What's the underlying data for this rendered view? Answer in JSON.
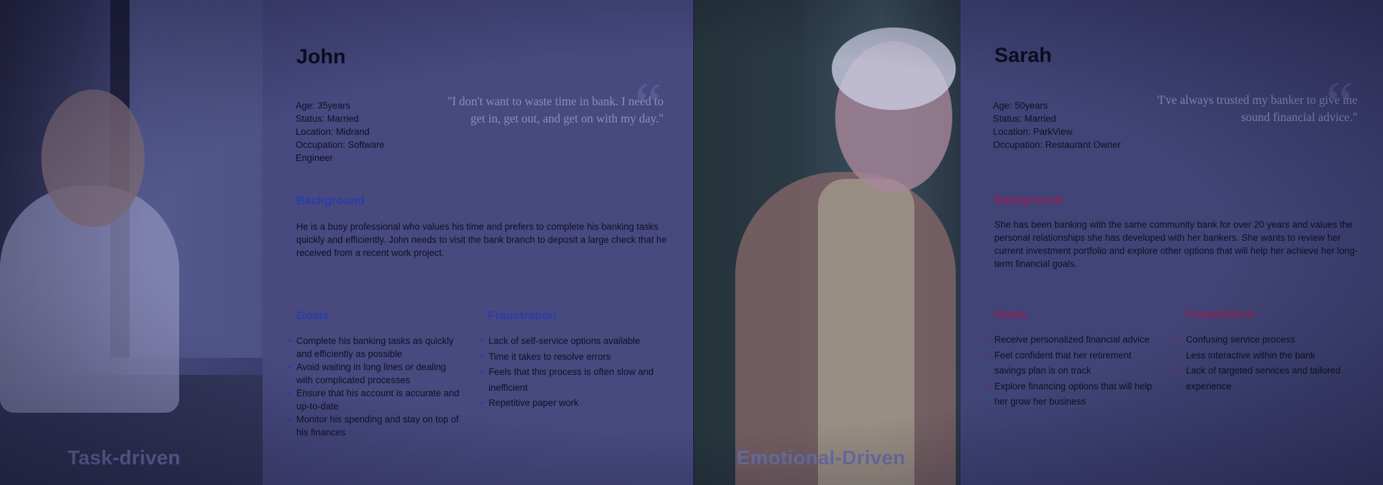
{
  "personas": [
    {
      "caption": "Task-driven",
      "name": "John",
      "meta": [
        "Age: 35years",
        "Status: Married",
        "Location: Midrand",
        "Occupation: Software",
        "Engineer"
      ],
      "quote_lines": [
        "\"I don't want to waste time in bank. I need to",
        "get in, get out, and get on with my day.\""
      ],
      "background_title": "Background",
      "background_text": "He is a busy professional who values his time and prefers to complete his banking tasks quickly and efficiently. John needs to visit the bank branch to deposit a large check that he received from a recent work project.",
      "goals_title": "Goals",
      "goals": [
        "Complete his banking tasks as quickly and efficiently as possible",
        "Avoid waiting in long lines or dealing with complicated processes",
        "Ensure that his account is accurate and up-to-date",
        "Monitor his spending and stay on top of his finances"
      ],
      "frustration_title": "Fraustration",
      "frustrations": [
        "Lack of self-service options available",
        "Time it takes to resolve errors",
        "Feels that this process is often slow and inefficient",
        "Repetitive paper work"
      ]
    },
    {
      "caption": "Emotional-Driven",
      "name": "Sarah",
      "meta": [
        "Age: 50years",
        "Status: Married",
        "Location: ParkView",
        "Occupation: Restaurant Owner"
      ],
      "quote_lines": [
        "'I've always trusted my banker to give me",
        "sound financial advice.\""
      ],
      "background_title": "Background",
      "background_text": "She has been banking with the same community bank for over 20 years and values the personal relationships she has developed with her bankers. She wants to review her current investment portfolio and explore other options that will help her achieve her long-term financial goals.",
      "goals_title": "Goals",
      "goals": [
        "Receive personalized financial advice",
        "Feel confident that her retirement savings plan is on track",
        "Explore financing options that will help her grow her business"
      ],
      "frustration_title": "Fraustration",
      "frustrations": [
        "Confusing service process",
        "Less interactive within the bank",
        "Lack of targeted services and tailored experience"
      ]
    }
  ]
}
